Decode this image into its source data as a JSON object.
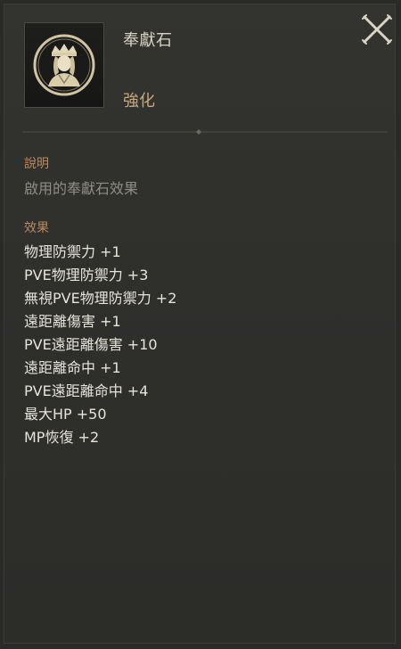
{
  "item": {
    "name": "奉獻石",
    "type": "強化",
    "icon": "goddess-portrait-icon"
  },
  "close_icon": "close-icon",
  "description": {
    "title": "說明",
    "text": "啟用的奉獻石效果"
  },
  "effects": {
    "title": "效果",
    "items": [
      "物理防禦力 +1",
      "PVE物理防禦力 +3",
      "無視PVE物理防禦力 +2",
      "遠距離傷害 +1",
      "PVE遠距離傷害 +10",
      "遠距離命中 +1",
      "PVE遠距離命中 +4",
      "最大HP +50",
      "MP恢復 +2"
    ]
  },
  "colors": {
    "accent": "#c9a87a",
    "section_title": "#b98a62",
    "text": "#e6e3dc",
    "muted": "#8e8c85"
  }
}
